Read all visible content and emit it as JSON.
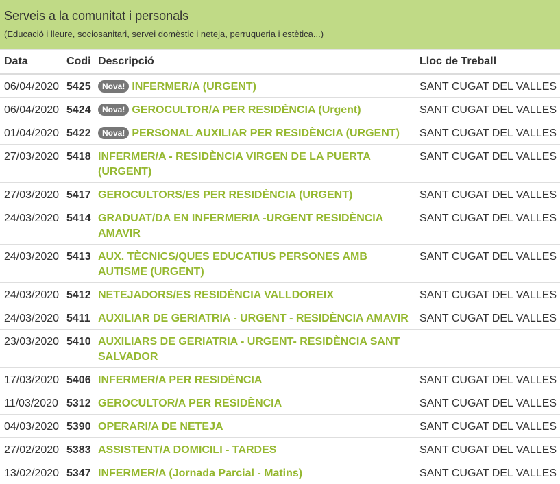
{
  "header": {
    "title": "Serveis a la comunitat i personals",
    "subtitle": "(Educació i lleure, sociosanitari, servei domèstic i neteja, perruqueria i estètica...)"
  },
  "table": {
    "columns": [
      "Data",
      "Codi",
      "Descripció",
      "Lloc de Treball"
    ],
    "rows": [
      {
        "date": "06/04/2020",
        "code": "5425",
        "badge": "Nova!",
        "description": "INFERMER/A (URGENT)",
        "location": "SANT CUGAT DEL VALLES"
      },
      {
        "date": "06/04/2020",
        "code": "5424",
        "badge": "Nova!",
        "description": "GEROCULTOR/A PER RESIDÈNCIA (Urgent)",
        "location": "SANT CUGAT DEL VALLES"
      },
      {
        "date": "01/04/2020",
        "code": "5422",
        "badge": "Nova!",
        "description": "PERSONAL AUXILIAR PER RESIDÈNCIA (URGENT)",
        "location": "SANT CUGAT DEL VALLES"
      },
      {
        "date": "27/03/2020",
        "code": "5418",
        "badge": "",
        "description": "INFERMER/A - RESIDÈNCIA VIRGEN DE LA PUERTA (URGENT)",
        "location": "SANT CUGAT DEL VALLES"
      },
      {
        "date": "27/03/2020",
        "code": "5417",
        "badge": "",
        "description": "GEROCULTORS/ES PER RESIDÈNCIA (URGENT)",
        "location": "SANT CUGAT DEL VALLES"
      },
      {
        "date": "24/03/2020",
        "code": "5414",
        "badge": "",
        "description": "GRADUAT/DA EN INFERMERIA -URGENT RESIDÈNCIA AMAVIR",
        "location": "SANT CUGAT DEL VALLES"
      },
      {
        "date": "24/03/2020",
        "code": "5413",
        "badge": "",
        "description": "AUX. TÈCNICS/QUES EDUCATIUS PERSONES AMB AUTISME (URGENT)",
        "location": "SANT CUGAT DEL VALLES"
      },
      {
        "date": "24/03/2020",
        "code": "5412",
        "badge": "",
        "description": "NETEJADORS/ES RESIDÈNCIA VALLDOREIX",
        "location": "SANT CUGAT DEL VALLES"
      },
      {
        "date": "24/03/2020",
        "code": "5411",
        "badge": "",
        "description": "AUXILIAR DE GERIATRIA - URGENT - RESIDÈNCIA AMAVIR",
        "location": "SANT CUGAT DEL VALLES"
      },
      {
        "date": "23/03/2020",
        "code": "5410",
        "badge": "",
        "description": "AUXILIARS DE GERIATRIA - URGENT- RESIDÈNCIA SANT SALVADOR",
        "location": ""
      },
      {
        "date": "17/03/2020",
        "code": "5406",
        "badge": "",
        "description": "INFERMER/A PER RESIDÈNCIA",
        "location": "SANT CUGAT DEL VALLES"
      },
      {
        "date": "11/03/2020",
        "code": "5312",
        "badge": "",
        "description": "GEROCULTOR/A PER RESIDÈNCIA",
        "location": "SANT CUGAT DEL VALLES"
      },
      {
        "date": "04/03/2020",
        "code": "5390",
        "badge": "",
        "description": "OPERARI/A DE NETEJA",
        "location": "SANT CUGAT DEL VALLES"
      },
      {
        "date": "27/02/2020",
        "code": "5383",
        "badge": "",
        "description": "ASSISTENT/A DOMICILI - TARDES",
        "location": "SANT CUGAT DEL VALLES"
      },
      {
        "date": "13/02/2020",
        "code": "5347",
        "badge": "",
        "description": "INFERMER/A (Jornada Parcial - Matins)",
        "location": "SANT CUGAT DEL VALLES"
      }
    ]
  },
  "colors": {
    "header_bg": "#c0da86",
    "link": "#95b830",
    "badge_bg": "#777777"
  }
}
